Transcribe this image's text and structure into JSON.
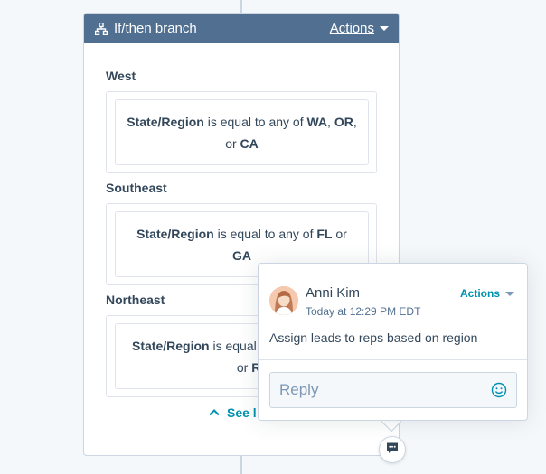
{
  "card": {
    "title": "If/then branch",
    "actions_label": "Actions",
    "branches": [
      {
        "name": "West",
        "property": "State/Region",
        "operator": " is equal to any of ",
        "values": [
          "WA",
          "OR",
          "CA"
        ],
        "joiners": [
          ", ",
          ", or "
        ]
      },
      {
        "name": "Southeast",
        "property": "State/Region",
        "operator": " is equal to any of ",
        "values": [
          "FL",
          "GA"
        ],
        "joiners": [
          " or "
        ]
      },
      {
        "name": "Northeast",
        "property": "State/Region",
        "operator": " is equal",
        "values": [
          "RI"
        ],
        "joiners": [
          " or "
        ]
      }
    ],
    "see_less_label": "See l"
  },
  "comment": {
    "author": "Anni Kim",
    "timestamp": "Today at 12:29 PM EDT",
    "actions_label": "Actions",
    "text": "Assign leads to reps based on region",
    "reply_placeholder": "Reply"
  },
  "colors": {
    "header_bg": "#516f90",
    "link": "#0091ae",
    "text": "#33475b"
  },
  "icons": {
    "header": "branch-icon",
    "header_actions": "caret-down-icon",
    "see_less": "chevron-up-icon",
    "emoji": "emoji-smiley-icon",
    "comment_toggle": "comment-icon"
  }
}
